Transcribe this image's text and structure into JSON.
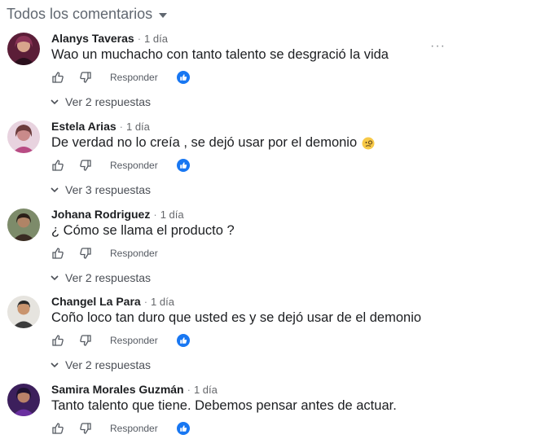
{
  "header": {
    "title": "Todos los comentarios"
  },
  "actions": {
    "reply_label": "Responder"
  },
  "comments": [
    {
      "author": "Alanys Taveras",
      "separator": "·",
      "time": "1 día",
      "text": "Wao un muchacho con tanto talento se desgració la vida",
      "replies": "Ver 2 respuestas",
      "avatar_color": "#7a2c4a"
    },
    {
      "author": "Estela Arias",
      "separator": "·",
      "time": "1 día",
      "text": "De verdad no lo creía , se dejó usar por el demonio",
      "replies": "Ver 3 respuestas",
      "avatar_color": "#c9a2b5"
    },
    {
      "author": "Johana Rodriguez",
      "separator": "·",
      "time": "1 día",
      "text": "¿ Cómo se llama el producto ?",
      "replies": "Ver 2 respuestas",
      "avatar_color": "#6d5a47"
    },
    {
      "author": "Changel La Para",
      "separator": "·",
      "time": "1 día",
      "text": "Coño loco tan duro que usted es y se dejó usar de el demonio",
      "replies": "Ver 2 respuestas",
      "avatar_color": "#d5d0c8"
    },
    {
      "author": "Samira Morales Guzmán",
      "separator": "·",
      "time": "1 día",
      "text": "Tanto talento que tiene. Debemos pensar antes de actuar.",
      "avatar_color": "#4a2a6a"
    }
  ]
}
